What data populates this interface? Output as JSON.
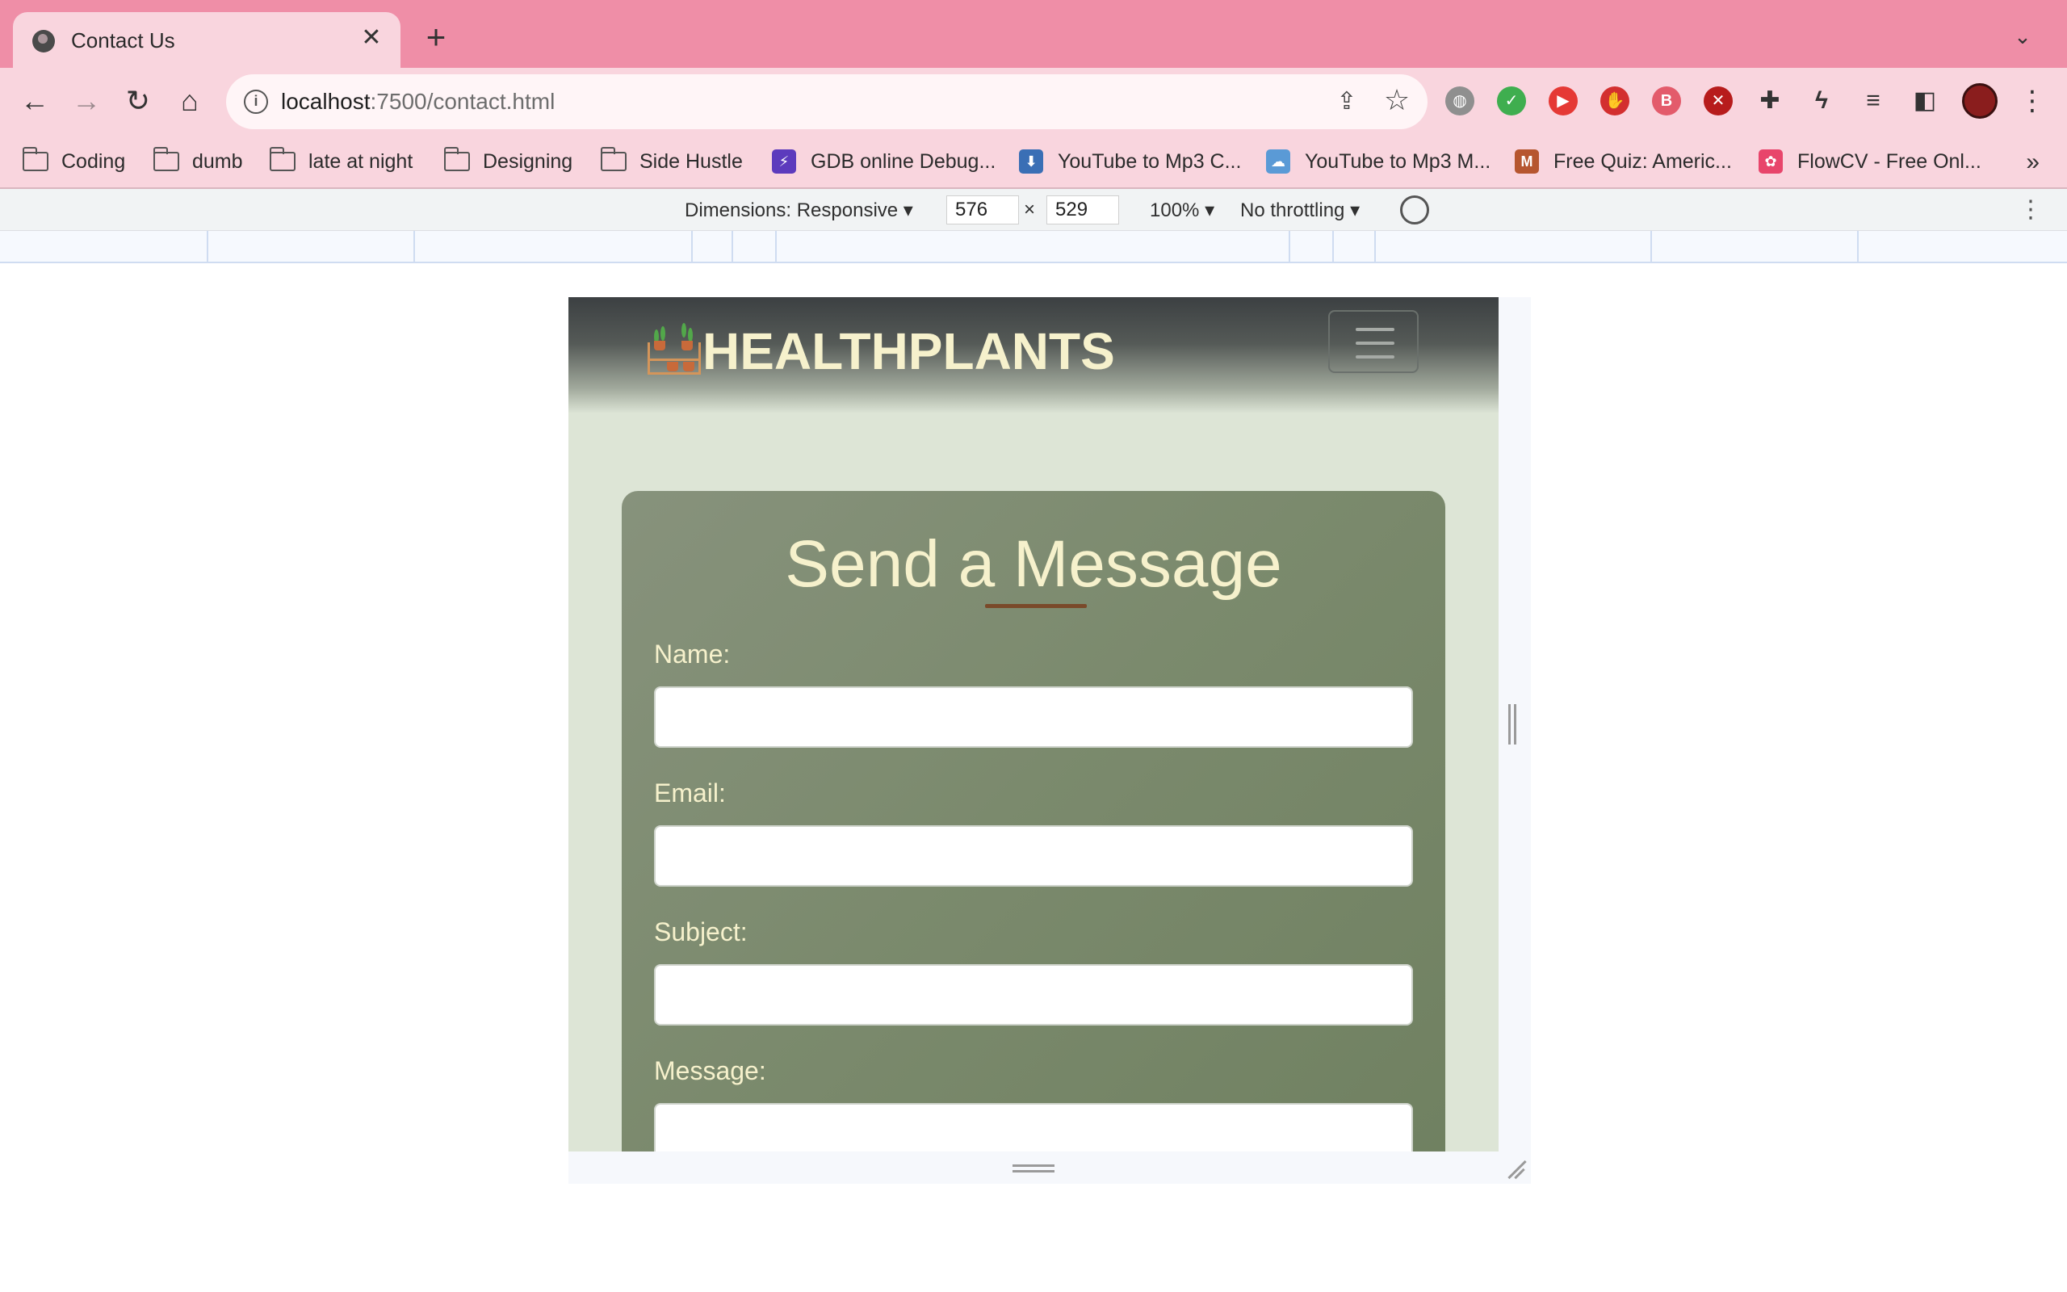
{
  "browser": {
    "tab": {
      "title": "Contact Us",
      "close": "✕"
    },
    "new_tab": "+",
    "tab_list": "⌄",
    "nav": {
      "back": "←",
      "forward": "→",
      "reload": "↻",
      "home": "⌂"
    },
    "url": {
      "host": "localhost",
      "rest": ":7500/contact.html"
    },
    "omnibox_icons": {
      "info": "i",
      "share": "⇪",
      "star": "☆"
    },
    "extensions": [
      {
        "name": "globe-extension-icon",
        "glyph": "◍",
        "color": "#8f8f8f"
      },
      {
        "name": "shield-extension-icon",
        "glyph": "✓",
        "color": "#3fae4f"
      },
      {
        "name": "video-extension-icon",
        "glyph": "▶",
        "color": "#e53935"
      },
      {
        "name": "adblock-extension-icon",
        "glyph": "✋",
        "color": "#d32f2f"
      },
      {
        "name": "b-extension-icon",
        "glyph": "B",
        "color": "#e35b6b"
      },
      {
        "name": "ublock-extension-icon",
        "glyph": "✕",
        "color": "#b71c1c"
      },
      {
        "name": "puzzle-extension-icon",
        "glyph": "✚",
        "color": "#333333"
      },
      {
        "name": "bolt-extension-icon",
        "glyph": "ϟ",
        "color": "#333333"
      },
      {
        "name": "reading-list-icon",
        "glyph": "≡",
        "color": "#333333"
      },
      {
        "name": "side-panel-icon",
        "glyph": "◧",
        "color": "#333333"
      }
    ],
    "menu": "⋮",
    "bookmarks": [
      {
        "label": "Coding",
        "type": "folder"
      },
      {
        "label": "dumb",
        "type": "folder"
      },
      {
        "label": "late at night",
        "type": "folder"
      },
      {
        "label": "Designing",
        "type": "folder"
      },
      {
        "label": "Side Hustle",
        "type": "folder"
      },
      {
        "label": "GDB online Debug...",
        "type": "site",
        "glyph": "⚡",
        "color": "#5c3bbd"
      },
      {
        "label": "YouTube to Mp3 C...",
        "type": "site",
        "glyph": "⬇",
        "color": "#3a6fb5"
      },
      {
        "label": "YouTube to Mp3 M...",
        "type": "site",
        "glyph": "☁",
        "color": "#5a9ad6"
      },
      {
        "label": "Free Quiz: Americ...",
        "type": "site",
        "glyph": "M",
        "color": "#b6562f"
      },
      {
        "label": "FlowCV - Free Onl...",
        "type": "site",
        "glyph": "✿",
        "color": "#e8456b"
      }
    ],
    "bookmarks_more": "»"
  },
  "devtools": {
    "dimensions_label": "Dimensions: Responsive",
    "width": "576",
    "times": "×",
    "height": "529",
    "zoom": "100%",
    "throttling": "No throttling",
    "caret": "▾",
    "more": "⋮"
  },
  "site": {
    "brand": "HEALTHPLANTS",
    "form": {
      "title": "Send a Message",
      "fields": [
        {
          "label": "Name:",
          "value": ""
        },
        {
          "label": "Email:",
          "value": ""
        },
        {
          "label": "Subject:",
          "value": ""
        },
        {
          "label": "Message:",
          "value": ""
        }
      ]
    }
  }
}
